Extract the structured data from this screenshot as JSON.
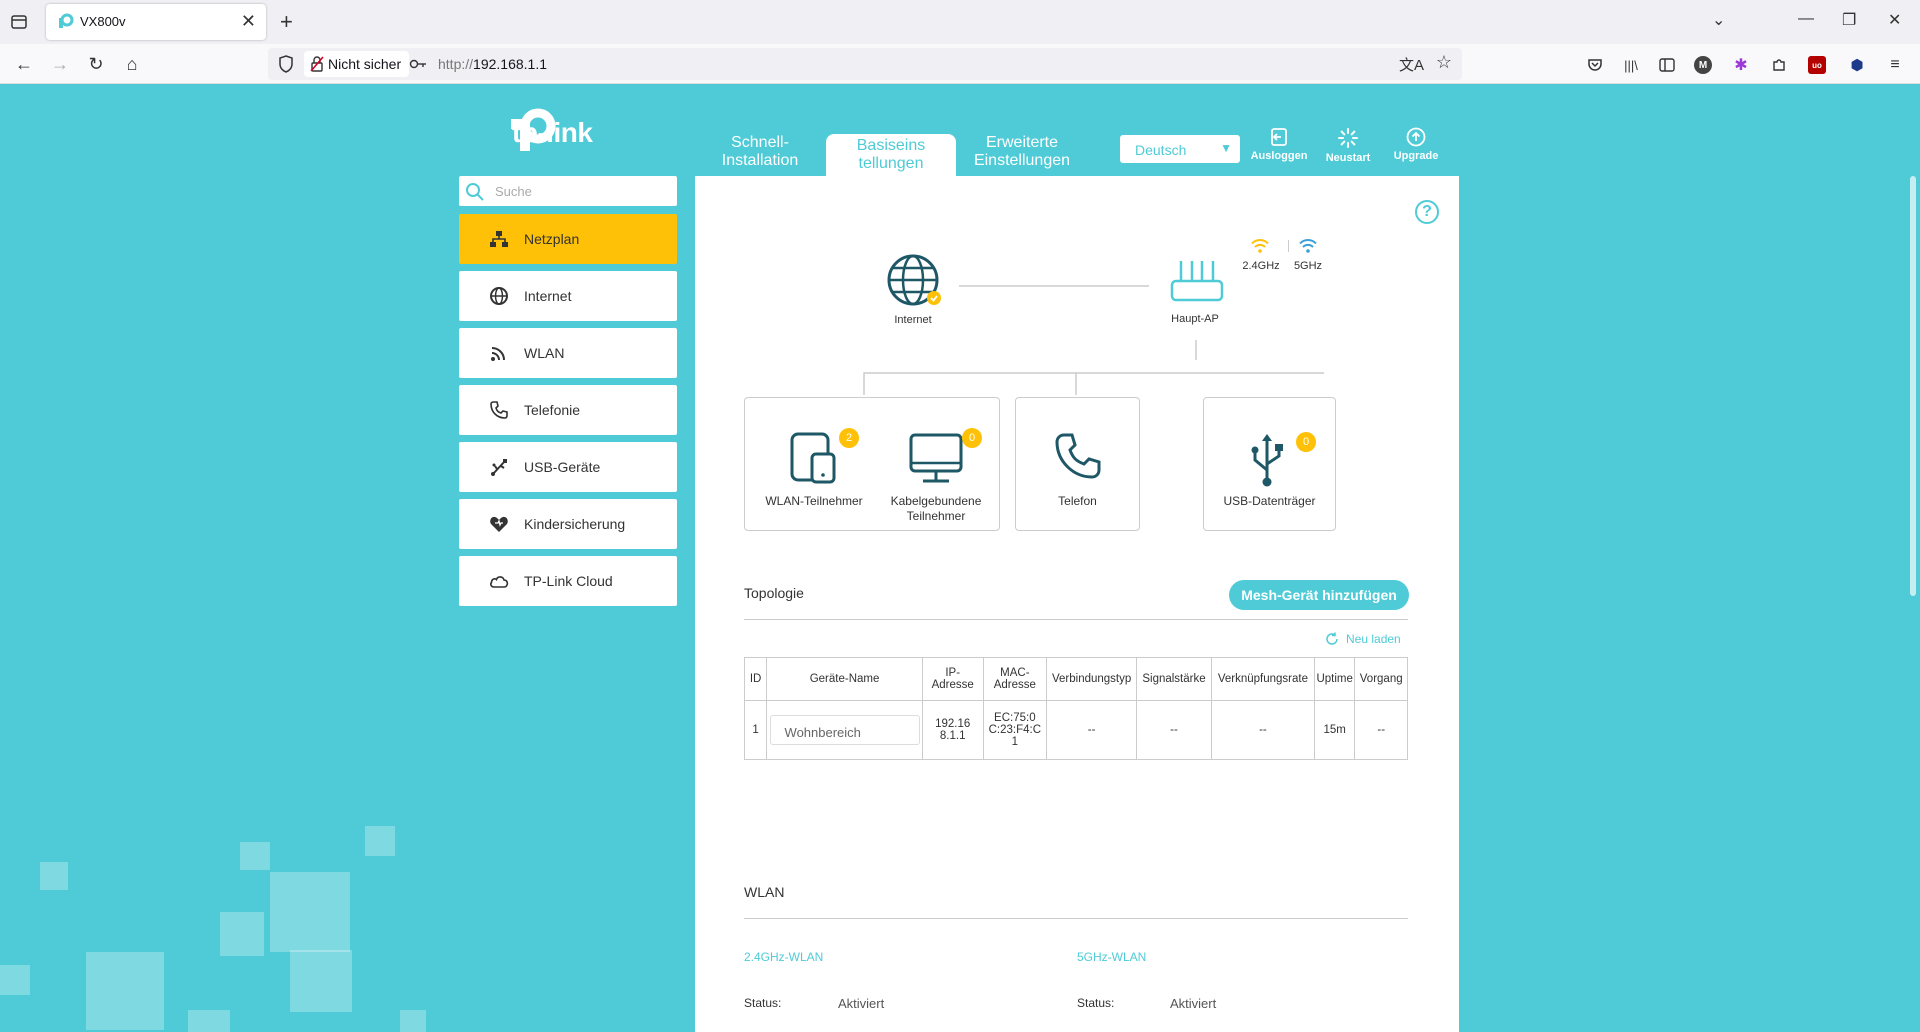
{
  "browser": {
    "tab_title": "VX800v",
    "security_label": "Nicht sicher",
    "url_proto": "http://",
    "url_host": "192.168.1.1"
  },
  "header": {
    "logo_text": "tp-link",
    "tabs": [
      {
        "line1": "Schnell-",
        "line2": "Installation"
      },
      {
        "line1": "Basiseins",
        "line2": "tellungen"
      },
      {
        "line1": "Erweiterte",
        "line2": "Einstellungen"
      }
    ],
    "language": "Deutsch",
    "actions": {
      "logout": "Ausloggen",
      "reboot": "Neustart",
      "upgrade": "Upgrade"
    }
  },
  "sidebar": {
    "search_placeholder": "Suche",
    "items": [
      {
        "label": "Netzplan"
      },
      {
        "label": "Internet"
      },
      {
        "label": "WLAN"
      },
      {
        "label": "Telefonie"
      },
      {
        "label": "USB-Geräte"
      },
      {
        "label": "Kindersicherung"
      },
      {
        "label": "TP-Link Cloud"
      }
    ]
  },
  "network_map": {
    "internet_label": "Internet",
    "router_label": "Haupt-AP",
    "band_24": "2.4GHz",
    "band_5": "5GHz",
    "wlan_clients": {
      "label": "WLAN-Teilnehmer",
      "count": "2"
    },
    "wired_clients": {
      "label_line1": "Kabelgebundene",
      "label_line2": "Teilnehmer",
      "count": "0"
    },
    "phone": {
      "label": "Telefon"
    },
    "usb": {
      "label": "USB-Datenträger",
      "count": "0"
    }
  },
  "topology": {
    "title": "Topologie",
    "mesh_button": "Mesh-Gerät hinzufügen",
    "reload": "Neu laden",
    "columns": {
      "id": "ID",
      "name": "Geräte-Name",
      "ip_1": "IP-",
      "ip_2": "Adresse",
      "mac_1": "MAC-",
      "mac_2": "Adresse",
      "conn": "Verbindungstyp",
      "signal": "Signalstärke",
      "rate": "Verknüpfungsrate",
      "uptime": "Uptime",
      "action": "Vorgang"
    },
    "rows": [
      {
        "id": "1",
        "name": "Wohnbereich",
        "ip_1": "192.16",
        "ip_2": "8.1.1",
        "mac_1": "EC:75:0",
        "mac_2": "C:23:F4:C",
        "mac_3": "1",
        "conn": "--",
        "signal": "--",
        "rate": "--",
        "uptime": "15m",
        "action": "--"
      }
    ]
  },
  "wlan": {
    "title": "WLAN",
    "band24_title": "2.4GHz-WLAN",
    "band5_title": "5GHz-WLAN",
    "status_label": "Status:",
    "band24_status": "Aktiviert",
    "band5_status": "Aktiviert"
  },
  "colors": {
    "brand": "#4ecbd6",
    "active": "#ffc107",
    "icon": "#1e5766"
  }
}
